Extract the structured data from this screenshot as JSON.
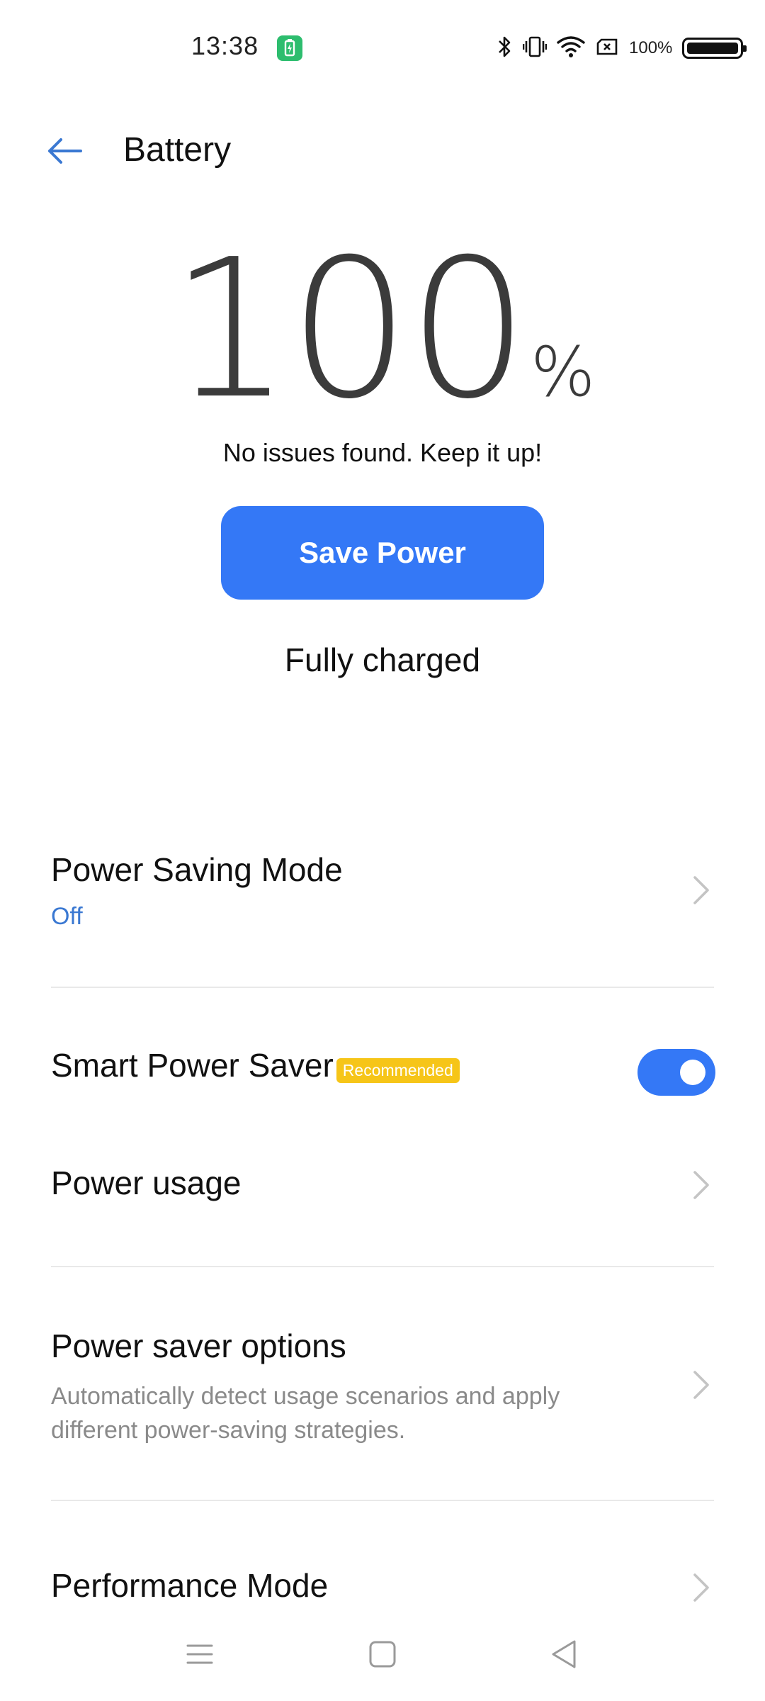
{
  "status_bar": {
    "time": "13:38",
    "battery_percent": "100%",
    "icons": [
      "charging-icon",
      "bluetooth-icon",
      "vibrate-icon",
      "wifi-icon",
      "no-sim-icon",
      "battery-icon"
    ]
  },
  "header": {
    "title": "Battery",
    "back_icon": "back-arrow-icon"
  },
  "battery": {
    "level": "100",
    "unit": "%",
    "message": "No issues found. Keep it up!",
    "save_power_label": "Save Power",
    "charge_status": "Fully charged"
  },
  "settings": {
    "power_saving_mode": {
      "title": "Power Saving Mode",
      "value": "Off"
    },
    "smart_power_saver": {
      "title": "Smart Power Saver",
      "badge": "Recommended",
      "enabled": true
    },
    "power_usage": {
      "title": "Power usage"
    },
    "power_saver_options": {
      "title": "Power saver options",
      "description_line1": "Automatically detect usage scenarios and apply",
      "description_line2": "different power-saving strategies."
    },
    "performance_mode": {
      "title": "Performance Mode"
    }
  },
  "colors": {
    "accent": "#3478f6",
    "badge": "#f6c518",
    "link_blue": "#3a78d2",
    "charging_green": "#2dbd6e"
  },
  "nav_bar": {
    "icons": [
      "menu-icon",
      "home-icon",
      "back-icon"
    ]
  }
}
